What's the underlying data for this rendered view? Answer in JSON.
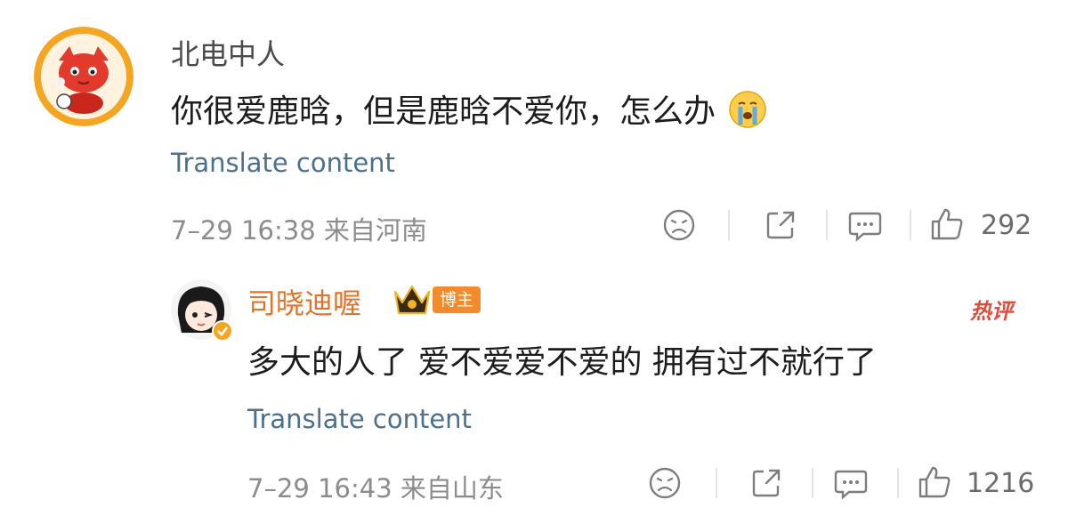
{
  "comment1": {
    "author": "北电中人",
    "text": "你很爱鹿晗，但是鹿晗不爱你，怎么办",
    "emoji": "crying-emoji",
    "translate": "Translate content",
    "meta": "7–29 16:38 来自河南",
    "likes": "292"
  },
  "reply1": {
    "author": "司晓迪喔",
    "badge": "博主",
    "hot_tag": "热评",
    "text": "多大的人了 爱不爱爱不爱的 拥有过不就行了",
    "translate": "Translate content",
    "meta": "7–29 16:43 来自山东",
    "likes": "1216"
  },
  "colors": {
    "link": "#4c6f8c",
    "author_highlight": "#e2742a",
    "badge": "#f28b2d",
    "hot": "#e04b3a"
  }
}
